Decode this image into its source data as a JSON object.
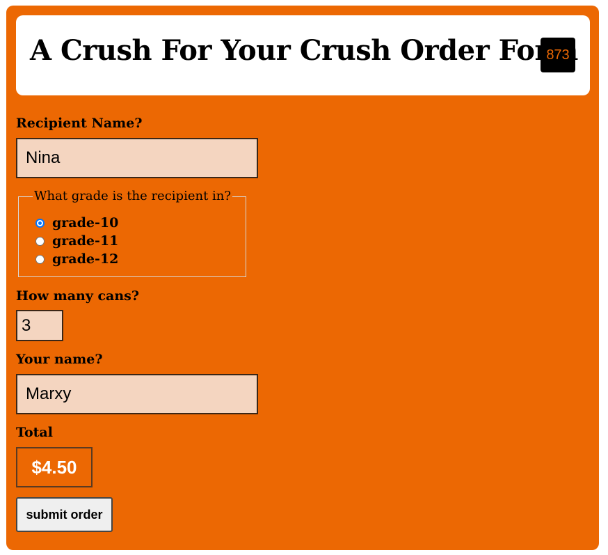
{
  "header": {
    "title": "A Crush For Your Crush Order Form",
    "badge": "873"
  },
  "form": {
    "recipient_label": "Recipient Name?",
    "recipient_value": "Nina",
    "grade_legend": "What grade is the recipient in?",
    "grades": [
      {
        "label": "grade-10",
        "checked": true
      },
      {
        "label": "grade-11",
        "checked": false
      },
      {
        "label": "grade-12",
        "checked": false
      }
    ],
    "cans_label": "How many cans?",
    "cans_value": "3",
    "your_name_label": "Your name?",
    "your_name_value": "Marxy",
    "total_label": "Total",
    "total_value": "$4.50",
    "submit_label": "submit order"
  },
  "colors": {
    "background": "#ec6803",
    "input_bg": "#f4d5c0",
    "badge_bg": "#000000"
  }
}
